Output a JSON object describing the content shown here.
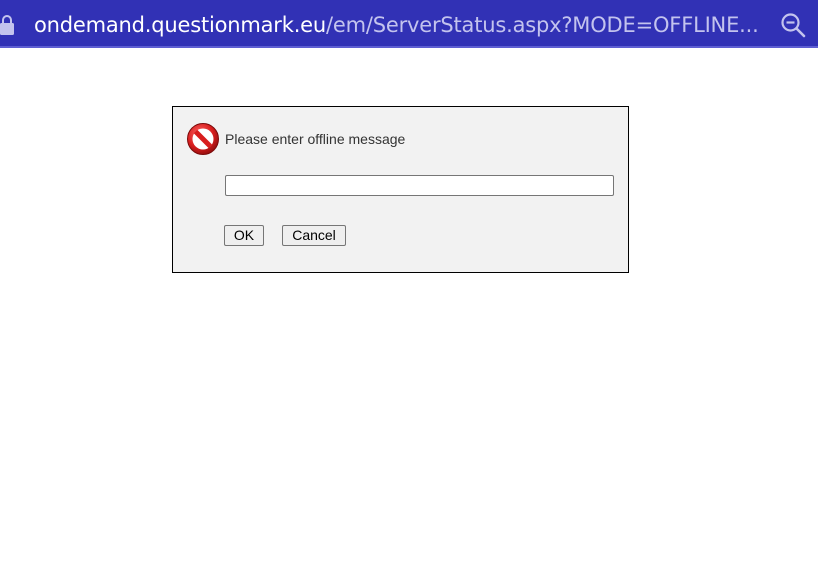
{
  "browser": {
    "url_host": "ondemand.questionmark.eu",
    "url_path": "/em/ServerStatus.aspx?MODE=OFFLINE...",
    "lock_icon": "lock-icon",
    "zoom_icon": "zoom-out-icon",
    "bar_color": "#3131b5"
  },
  "dialog": {
    "icon": "stop-icon",
    "prompt": "Please enter offline message",
    "input_value": "",
    "ok_label": "OK",
    "cancel_label": "Cancel"
  }
}
